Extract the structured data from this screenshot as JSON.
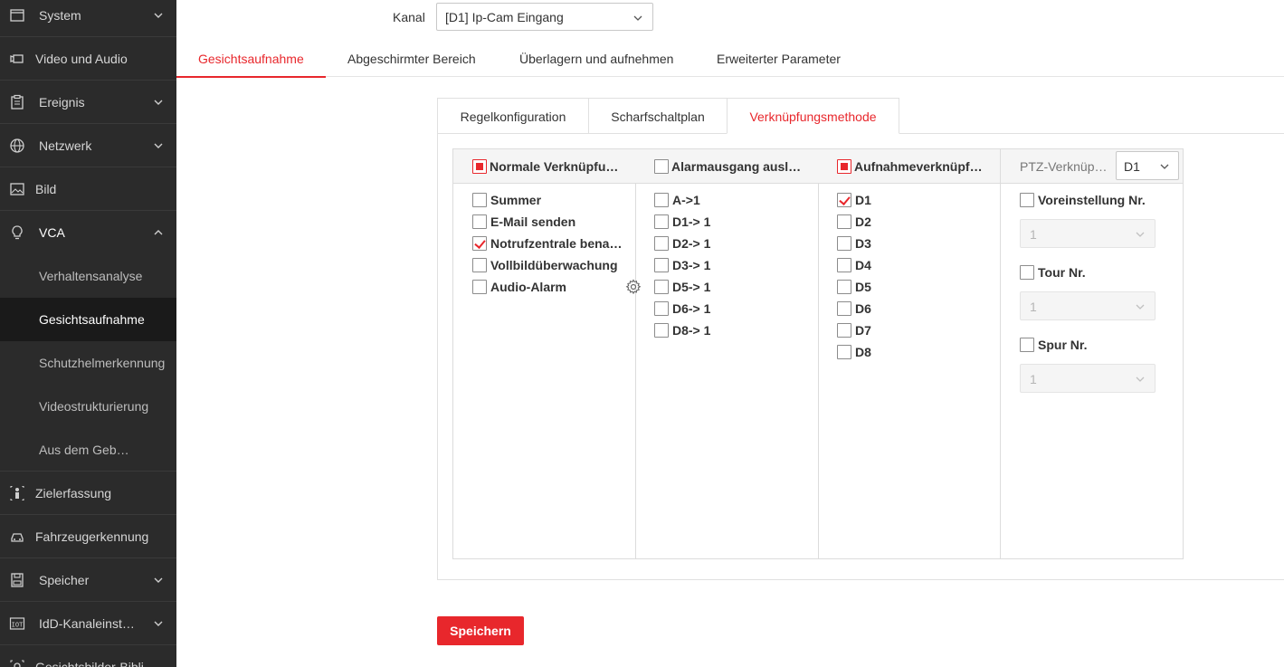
{
  "sidebar": {
    "items": [
      {
        "label": "System",
        "icon": "window-icon"
      },
      {
        "label": "Video und Audio",
        "icon": "video-camera-icon"
      },
      {
        "label": "Ereignis",
        "icon": "clipboard-icon"
      },
      {
        "label": "Netzwerk",
        "icon": "globe-icon"
      },
      {
        "label": "Bild",
        "icon": "image-icon"
      },
      {
        "label": "VCA",
        "icon": "lightbulb-icon"
      },
      {
        "label": "Zielerfassung",
        "icon": "person-target-icon"
      },
      {
        "label": "Fahrzeugerkennung",
        "icon": "car-icon"
      },
      {
        "label": "Speicher",
        "icon": "disk-icon"
      },
      {
        "label": "IdD-Kanaleinst…",
        "icon": "iot-icon"
      },
      {
        "label": "Gesichtsbilder-Bibli…",
        "icon": "face-icon"
      }
    ],
    "vca_sub": [
      {
        "label": "Verhaltensanalyse"
      },
      {
        "label": "Gesichtsaufnahme"
      },
      {
        "label": "Schutzhelmerkennung"
      },
      {
        "label": "Videostrukturierung"
      },
      {
        "label": "Aus dem Geb…"
      }
    ]
  },
  "kanal": {
    "label": "Kanal",
    "value": "[D1] Ip-Cam Eingang"
  },
  "main_tabs": [
    "Gesichtsaufnahme",
    "Abgeschirmter Bereich",
    "Überlagern und aufnehmen",
    "Erweiterter Parameter"
  ],
  "sub_tabs": [
    "Regelkonfiguration",
    "Scharfschaltplan",
    "Verknüpfungsmethode"
  ],
  "columns": {
    "normal": {
      "header": "Normale Verknüpfu…",
      "options": [
        {
          "label": "Summer",
          "checked": false
        },
        {
          "label": "E-Mail senden",
          "checked": false
        },
        {
          "label": "Notrufzentrale bena…",
          "checked": true
        },
        {
          "label": "Vollbildüberwachung",
          "checked": false
        },
        {
          "label": "Audio-Alarm",
          "checked": false
        }
      ]
    },
    "alarm": {
      "header": "Alarmausgang ausl…",
      "options": [
        {
          "label": "A->1",
          "checked": false
        },
        {
          "label": "D1-> 1",
          "checked": false
        },
        {
          "label": "D2-> 1",
          "checked": false
        },
        {
          "label": "D3-> 1",
          "checked": false
        },
        {
          "label": "D5-> 1",
          "checked": false
        },
        {
          "label": "D6-> 1",
          "checked": false
        },
        {
          "label": "D8-> 1",
          "checked": false
        }
      ]
    },
    "record": {
      "header": "Aufnahmeverknüpf…",
      "options": [
        {
          "label": "D1",
          "checked": true
        },
        {
          "label": "D2",
          "checked": false
        },
        {
          "label": "D3",
          "checked": false
        },
        {
          "label": "D4",
          "checked": false
        },
        {
          "label": "D5",
          "checked": false
        },
        {
          "label": "D6",
          "checked": false
        },
        {
          "label": "D7",
          "checked": false
        },
        {
          "label": "D8",
          "checked": false
        }
      ]
    },
    "ptz": {
      "header": "PTZ-Verknüp…",
      "channel": "D1",
      "preset": {
        "label": "Voreinstellung Nr.",
        "value": "1"
      },
      "tour": {
        "label": "Tour Nr.",
        "value": "1"
      },
      "spur": {
        "label": "Spur Nr.",
        "value": "1"
      }
    }
  },
  "save_label": "Speichern",
  "colors": {
    "accent": "#e8272c",
    "sidebar_bg": "#2b2b2b",
    "sidebar_active": "#1a1a1a"
  }
}
